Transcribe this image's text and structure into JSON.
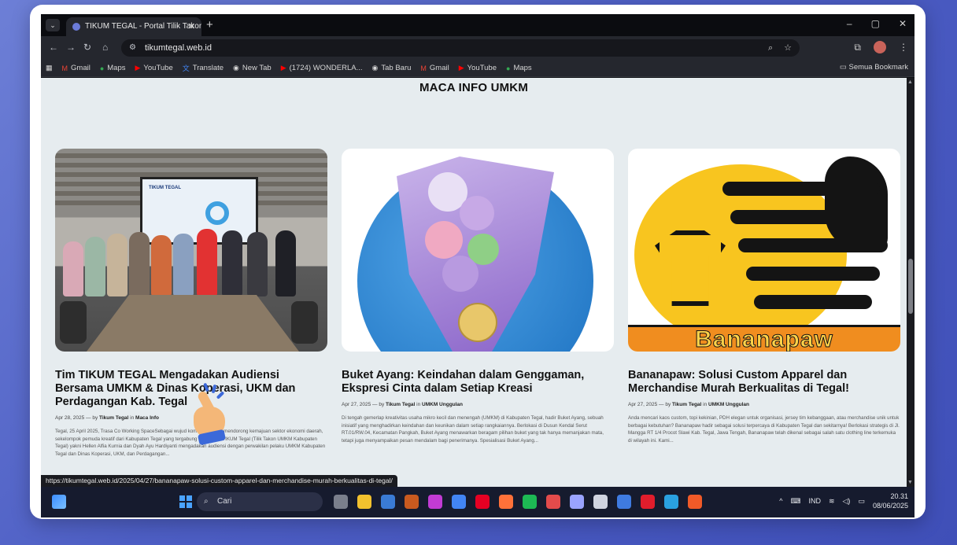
{
  "browser": {
    "tab_title": "TIKUM TEGAL - Portal Tilik Takon",
    "tab_close": "✕",
    "new_tab": "+",
    "url": "tikumtegal.web.id",
    "window_controls": [
      "–",
      "▢",
      "✕"
    ]
  },
  "bookmarks": {
    "items": [
      {
        "icon": "gmail-icon",
        "label": "Gmail"
      },
      {
        "icon": "maps-icon",
        "label": "Maps"
      },
      {
        "icon": "youtube-icon",
        "label": "YouTube"
      },
      {
        "icon": "translate-icon",
        "label": "Translate"
      },
      {
        "icon": "chrome-icon",
        "label": "New Tab"
      },
      {
        "icon": "youtube-icon",
        "label": "(1724) WONDERLA..."
      },
      {
        "icon": "chrome-icon",
        "label": "Tab Baru"
      },
      {
        "icon": "gmail-icon",
        "label": "Gmail"
      },
      {
        "icon": "youtube-icon",
        "label": "YouTube"
      },
      {
        "icon": "maps-icon",
        "label": "Maps"
      }
    ],
    "all_bookmarks": "Semua Bookmark"
  },
  "page": {
    "section_title": "MACA INFO UMKM",
    "articles": [
      {
        "title": "Tim TIKUM TEGAL Mengadakan Audiensi Bersama UMKM & Dinas Koperasi, UKM dan Perdagangan Kab. Tegal",
        "date": "Apr 28, 2025 — by",
        "author": "Tikum Tegal",
        "category_prefix": "in",
        "category": "Maca Info",
        "excerpt": "Tegal, 25 April 2025, Trasa Co Working SpaceSebagai wujud komitmen untuk mendorong kemajuan sektor ekonomi daerah, sekelompok pemuda kreatif dari Kabupaten Tegal yang tergabung dalam Tim TIKUM Tegal (Tilik Takon UMKM Kabupaten Tegal) yakni Hellen Alfia Kurnia dan Dyah Ayu Hardiyanti mengadakan audiensi dengan perwakilan pelaku UMKM Kabupaten Tegal dan Dinas Koperasi, UKM, dan Perdagangan...",
        "image_text": "TIKUM TEGAL"
      },
      {
        "title": "Buket Ayang: Keindahan dalam Genggaman, Ekspresi Cinta dalam Setiap Kreasi",
        "date": "Apr 27, 2025 — by",
        "author": "Tikum Tegal",
        "category_prefix": "in",
        "category": "UMKM Unggulan",
        "excerpt": "Di tengah gemerlap kreativitas usaha mikro kecil dan menengah (UMKM) di Kabupaten Tegal, hadir Buket Ayang, sebuah inisiatif yang menghadirkan keindahan dan keunikan dalam setiap rangkaiannya. Berlokasi di Dusun Kendal Serut RT.01/RW.04, Kecamatan Pangkah, Buket Ayang menawarkan beragam pilihan buket yang tak hanya memanjakan mata, tetapi juga menyampaikan pesan mendalam bagi penerimanya. Spesialisasi Buket Ayang..."
      },
      {
        "title": "Bananapaw: Solusi Custom Apparel dan Merchandise Murah Berkualitas di Tegal!",
        "date": "Apr 27, 2025 — by",
        "author": "Tikum Tegal",
        "category_prefix": "in",
        "category": "UMKM Unggulan",
        "excerpt": "Anda mencari kaos custom, topi kekinian, PDH elegan untuk organisasi, jersey tim kebanggaan, atau merchandise unik untuk berbagai kebutuhan? Bananapaw hadir sebagai solusi terpercaya di Kabupaten Tegal dan sekitarnya! Berlokasi strategis di Jl. Mangga RT 1/4 Procot Slawi Kab. Tegal, Jawa Tengah, Bananapaw telah dikenal sebagai salah satu clothing line terkemuka di wilayah ini. Kami...",
        "image_text": "Bananapaw"
      }
    ]
  },
  "status_link": "https://tikumtegal.web.id/2025/04/27/bananapaw-solusi-custom-apparel-dan-merchandise-murah-berkualitas-di-tegal/",
  "taskbar": {
    "search_label": "Cari",
    "language": "IND",
    "time": "20.31",
    "date": "08/06/2025",
    "app_colors": [
      "#7a7f8c",
      "#f2c12e",
      "#3a7bd5",
      "#c95a1f",
      "#c23bd4",
      "#4285f4",
      "#e60023",
      "#ff7139",
      "#1db954",
      "#e34b4b",
      "#9aa3ff",
      "#d0d4e0",
      "#3f7be0",
      "#e11d2c",
      "#2aa1e0",
      "#f05a28"
    ]
  },
  "colors": {
    "page_bg": "#e6ecef",
    "desktop_bg": "#4d5ec4",
    "accent_blue": "#3c69d9"
  }
}
